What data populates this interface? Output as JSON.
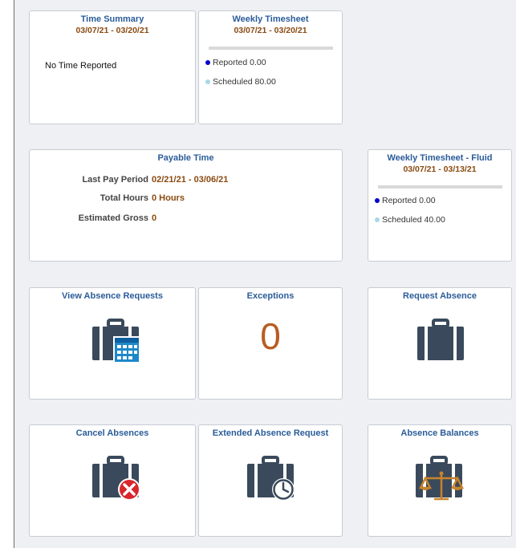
{
  "tiles": {
    "time_summary": {
      "title": "Time Summary",
      "period": "03/07/21 - 03/20/21",
      "message": "No Time Reported"
    },
    "weekly_timesheet": {
      "title": "Weekly Timesheet",
      "period": "03/07/21 - 03/20/21",
      "reported": "Reported 0.00",
      "scheduled": "Scheduled 80.00"
    },
    "payable_time": {
      "title": "Payable Time",
      "last_pay_period_label": "Last Pay Period",
      "last_pay_period_value": "02/21/21 - 03/06/21",
      "total_hours_label": "Total Hours",
      "total_hours_value": "0 Hours",
      "estimated_gross_label": "Estimated Gross",
      "estimated_gross_value": "0"
    },
    "weekly_timesheet_fluid": {
      "title": "Weekly Timesheet - Fluid",
      "period": "03/07/21 - 03/13/21",
      "reported": "Reported 0.00",
      "scheduled": "Scheduled 40.00"
    },
    "view_absence_requests": {
      "title": "View Absence Requests",
      "icon": "briefcase-calendar-icon"
    },
    "exceptions": {
      "title": "Exceptions",
      "count": "0"
    },
    "request_absence": {
      "title": "Request Absence",
      "icon": "briefcase-icon"
    },
    "cancel_absences": {
      "title": "Cancel Absences",
      "icon": "briefcase-cancel-icon"
    },
    "extended_absence_request": {
      "title": "Extended Absence Request",
      "icon": "briefcase-clock-icon"
    },
    "absence_balances": {
      "title": "Absence Balances",
      "icon": "briefcase-scale-icon"
    }
  },
  "colors": {
    "title_blue": "#2a5c99",
    "date_brown": "#8a4a10",
    "reported_dot": "#0000cc",
    "scheduled_dot": "#a8d8e8",
    "exceptions_orange": "#b85d22",
    "briefcase": "#3a4a5c"
  }
}
